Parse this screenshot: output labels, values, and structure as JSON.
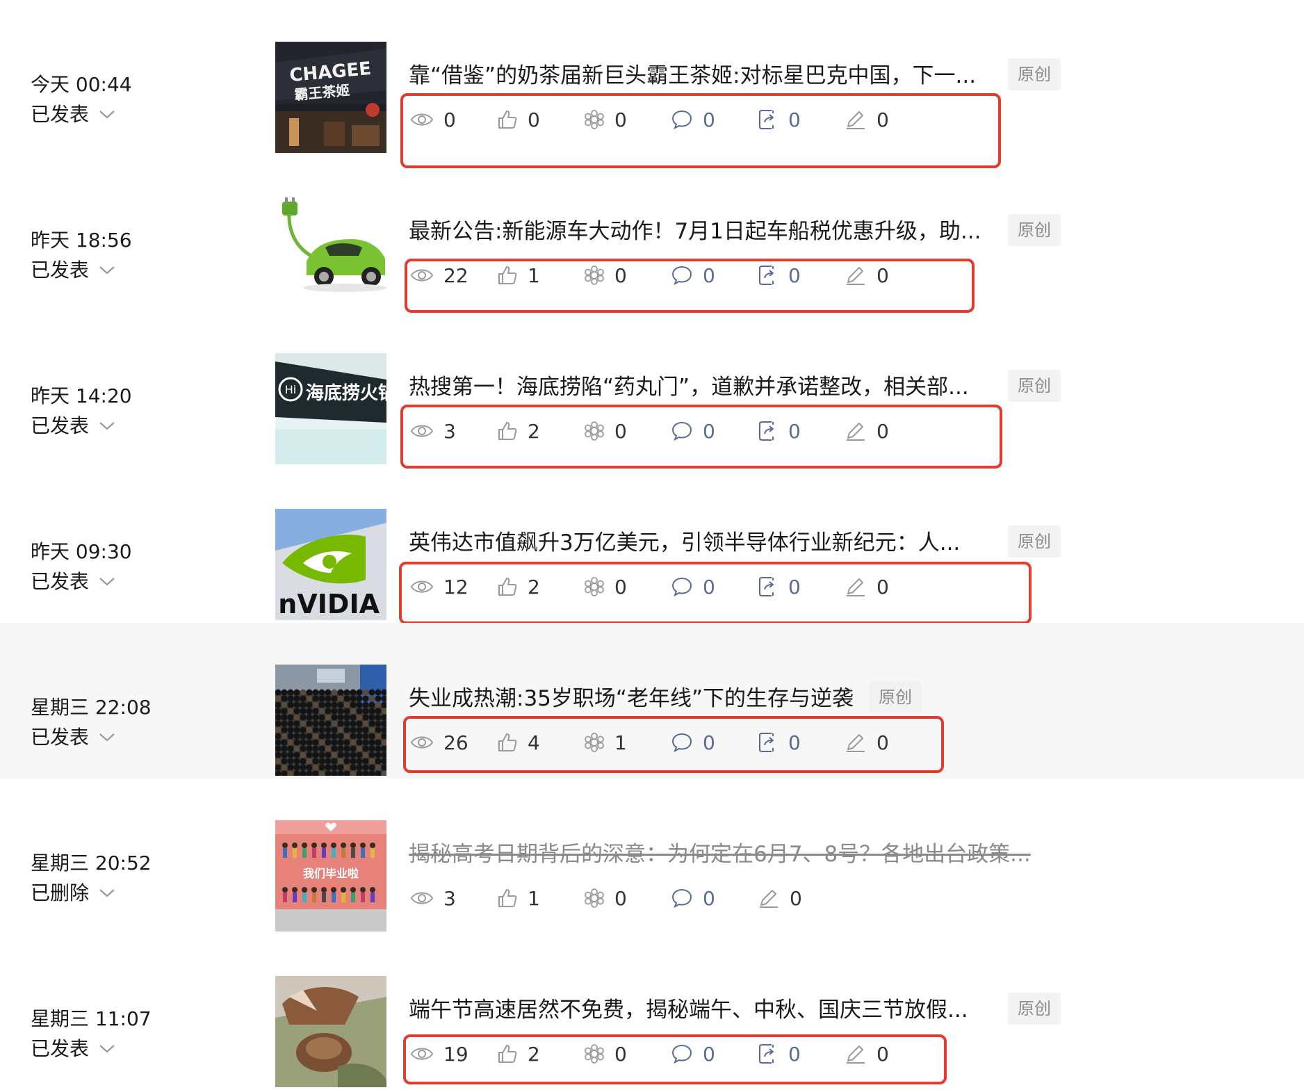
{
  "colors": {
    "link_blue": "#576b95",
    "highlight_red": "#e03c2f",
    "muted": "#8c8c8c"
  },
  "articles": [
    {
      "date": "今天 00:44",
      "status": "已发表",
      "title": "靠“借鉴”的奶茶届新巨头霸王茶姬:对标星巴克中国，下一...",
      "badge": "原创",
      "views": "0",
      "likes": "0",
      "wow": "0",
      "comments": "0",
      "shares": "0",
      "notes": "0",
      "thumbnail": "chagee-storefront",
      "thumb_text": [
        "CHAGEE",
        "霸王茶姬"
      ]
    },
    {
      "date": "昨天 18:56",
      "status": "已发表",
      "title": "最新公告:新能源车大动作！7月1日起车船税优惠升级，助...",
      "badge": "原创",
      "views": "22",
      "likes": "1",
      "wow": "0",
      "comments": "0",
      "shares": "0",
      "notes": "0",
      "thumbnail": "green-electric-car"
    },
    {
      "date": "昨天 14:20",
      "status": "已发表",
      "title": "热搜第一！海底捞陷“药丸门”，道歉并承诺整改，相关部...",
      "badge": "原创",
      "views": "3",
      "likes": "2",
      "wow": "0",
      "comments": "0",
      "shares": "0",
      "notes": "0",
      "thumbnail": "haidilao-sign",
      "thumb_text": [
        "海底捞火锅"
      ]
    },
    {
      "date": "昨天 09:30",
      "status": "已发表",
      "title": "英伟达市值飙升3万亿美元，引领半导体行业新纪元：人...",
      "badge": "原创",
      "views": "12",
      "likes": "2",
      "wow": "0",
      "comments": "0",
      "shares": "0",
      "notes": "0",
      "thumbnail": "nvidia-logo",
      "thumb_text": [
        "nVIDIA"
      ]
    },
    {
      "date": "星期三 22:08",
      "status": "已发表",
      "title": "失业成热潮:35岁职场“老年线”下的生存与逆袭",
      "badge": "原创",
      "views": "26",
      "likes": "4",
      "wow": "1",
      "comments": "0",
      "shares": "0",
      "notes": "0",
      "thumbnail": "job-fair-crowd"
    },
    {
      "date": "星期三 20:52",
      "status": "已删除",
      "title": "揭秘高考日期背后的深意：为何定在6月7、8号？各地出台政策...",
      "badge": "",
      "views": "3",
      "likes": "1",
      "wow": "0",
      "comments": "0",
      "shares": "",
      "notes": "0",
      "thumbnail": "graduation-illustration",
      "thumb_text": [
        "我们毕业啦"
      ]
    },
    {
      "date": "星期三 11:07",
      "status": "已发表",
      "title": "端午节高速居然不免费，揭秘端午、中秋、国庆三节放假...",
      "badge": "原创",
      "views": "19",
      "likes": "2",
      "wow": "0",
      "comments": "0",
      "shares": "0",
      "notes": "0",
      "thumbnail": "zongzi-food"
    }
  ]
}
